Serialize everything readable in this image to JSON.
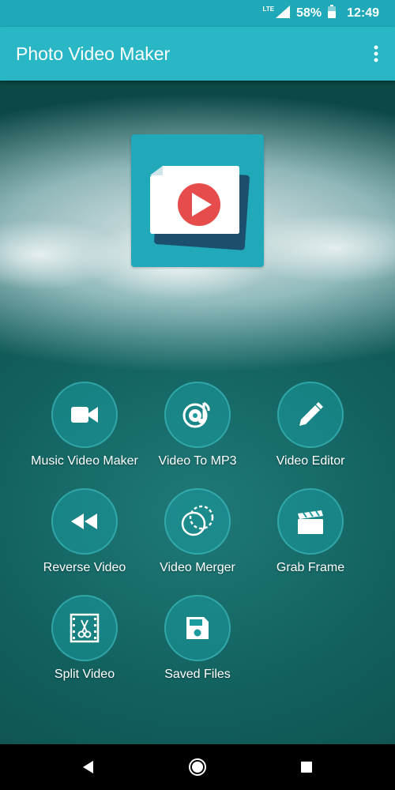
{
  "status_bar": {
    "network": "LTE",
    "battery": "58%",
    "time": "12:49"
  },
  "app_bar": {
    "title": "Photo Video Maker",
    "menu_icon": "more-vert-icon"
  },
  "logo": {
    "icon": "video-play-icon"
  },
  "menu": [
    {
      "label": "Music Video Maker",
      "icon": "videocam-icon"
    },
    {
      "label": "Video To MP3",
      "icon": "music-disc-icon"
    },
    {
      "label": "Video Editor",
      "icon": "pencil-icon"
    },
    {
      "label": "Reverse Video",
      "icon": "rewind-icon"
    },
    {
      "label": "Video Merger",
      "icon": "merge-circles-icon"
    },
    {
      "label": "Grab Frame",
      "icon": "clapperboard-icon"
    },
    {
      "label": "Split Video",
      "icon": "film-scissors-icon"
    },
    {
      "label": "Saved Files",
      "icon": "save-icon"
    }
  ],
  "nav_bar": {
    "back": "back-icon",
    "home": "home-icon",
    "recents": "recents-icon"
  },
  "colors": {
    "status_bar": "#1ea8b8",
    "app_bar": "#29b6c5",
    "accent_red": "#e74c4c"
  }
}
